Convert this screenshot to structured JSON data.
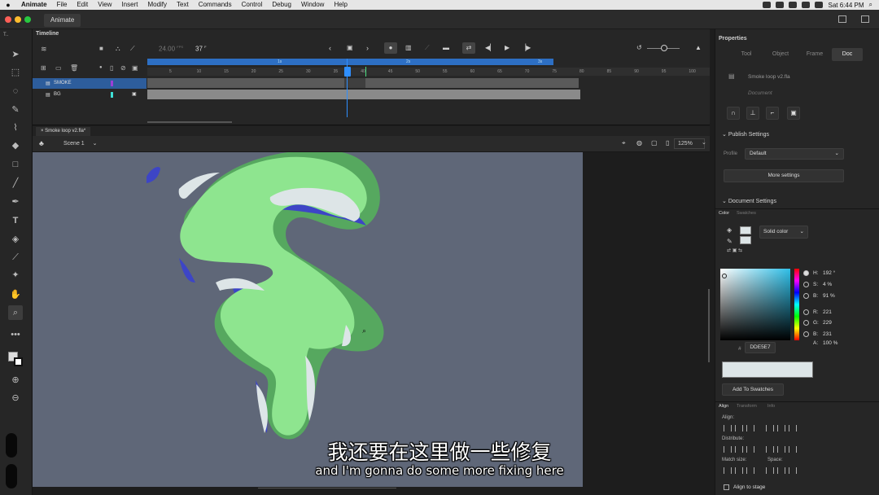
{
  "menubar": {
    "app_name": "Animate",
    "items": [
      "File",
      "Edit",
      "View",
      "Insert",
      "Modify",
      "Text",
      "Commands",
      "Control",
      "Debug",
      "Window",
      "Help"
    ],
    "clock": "Sat 6:44 PM"
  },
  "titlebar": {
    "tab": "Animate"
  },
  "timeline": {
    "title": "Timeline",
    "fps": "24.00",
    "fps_unit": "FPS",
    "frame": "37",
    "frame_unit": "F",
    "layers": [
      {
        "name": "SMOKE",
        "color": "#9b40d6",
        "selected": true
      },
      {
        "name": "BG",
        "color": "#3fe0d6",
        "selected": false
      }
    ],
    "ruler_numbers": [
      "5",
      "10",
      "15",
      "20",
      "25",
      "30",
      "35",
      "40",
      "45",
      "50",
      "55",
      "60",
      "65",
      "70",
      "75",
      "80",
      "85",
      "90",
      "95",
      "100"
    ],
    "span_labels": [
      "1s",
      "2s",
      "3s"
    ]
  },
  "document": {
    "tab": "Smoke loop v2.fla*",
    "scene": "Scene 1",
    "zoom": "125%"
  },
  "subtitle": {
    "zh": "我还要在这里做一些修复",
    "en": "and I'm gonna do some more fixing here"
  },
  "properties": {
    "title": "Properties",
    "tabs": [
      "Tool",
      "Object",
      "Frame",
      "Doc"
    ],
    "active_tab": "Doc",
    "doc_name": "Smoke loop v2.fla",
    "doc_label": "Document",
    "publish_settings": "Publish Settings",
    "profile_label": "Profile",
    "profile_value": "Default",
    "more_settings": "More settings",
    "document_settings": "Document Settings"
  },
  "color_panel": {
    "tabs": [
      "Color",
      "Swatches"
    ],
    "fill_type": "Solid color",
    "hsb": [
      {
        "label": "H:",
        "value": "192 °"
      },
      {
        "label": "S:",
        "value": "4 %"
      },
      {
        "label": "B:",
        "value": "91 %"
      }
    ],
    "rgb": [
      {
        "label": "R:",
        "value": "221"
      },
      {
        "label": "G:",
        "value": "229"
      },
      {
        "label": "B:",
        "value": "231"
      }
    ],
    "alpha_label": "A:",
    "alpha_value": "100 %",
    "hex_label": "#",
    "hex": "DDE5E7",
    "swatch_color": "#dde5e7",
    "add_to_swatches": "Add To Swatches"
  },
  "align_panel": {
    "tabs": [
      "Align",
      "Transform",
      "Info"
    ],
    "align_label": "Align:",
    "distribute_label": "Distribute:",
    "match_size_label": "Match size:",
    "space_label": "Space:",
    "align_to_stage": "Align to stage"
  },
  "colors": {
    "stage": "#5f6778",
    "smoke_light": "#8ee58f",
    "smoke_dark": "#56a85f",
    "smoke_shadow": "#3d45c6",
    "smoke_highlight": "#dde5e7",
    "accent_blue": "#3f7ad4",
    "playhead": "#2f8fff"
  },
  "icons": [
    "apple-icon",
    "search-icon",
    "wifi-icon",
    "battery-icon",
    "selection-icon",
    "pencil-icon",
    "brush-icon",
    "eraser-icon",
    "rectangle-icon",
    "line-icon",
    "text-icon",
    "paint-bucket-icon",
    "eyedropper-icon",
    "hand-icon",
    "zoom-icon",
    "play-icon",
    "loop-icon",
    "lock-icon",
    "eye-icon"
  ]
}
